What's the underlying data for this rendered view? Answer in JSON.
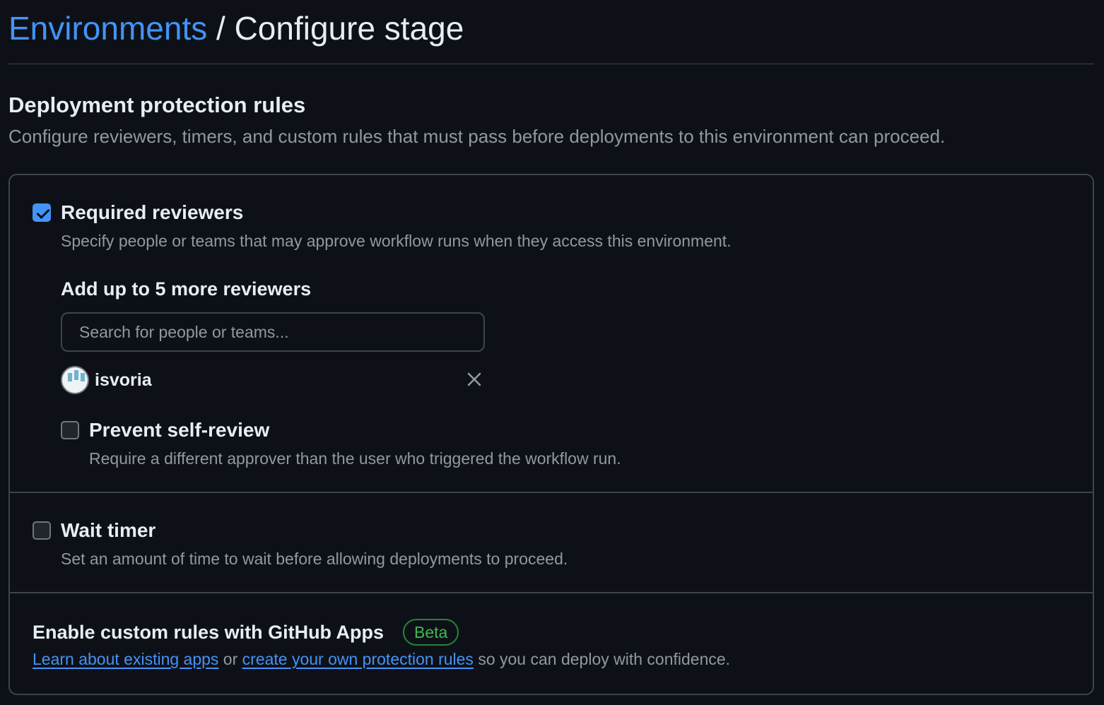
{
  "breadcrumb": {
    "parent": "Environments",
    "separator": " / ",
    "current": "Configure stage"
  },
  "section": {
    "title": "Deployment protection rules",
    "description": "Configure reviewers, timers, and custom rules that must pass before deployments to this environment can proceed."
  },
  "required_reviewers": {
    "checked": true,
    "label": "Required reviewers",
    "description": "Specify people or teams that may approve workflow runs when they access this environment.",
    "add_label": "Add up to 5 more reviewers",
    "search_placeholder": "Search for people or teams...",
    "reviewers": [
      {
        "name": "isvoria"
      }
    ],
    "prevent_self_review": {
      "checked": false,
      "label": "Prevent self-review",
      "description": "Require a different approver than the user who triggered the workflow run."
    }
  },
  "wait_timer": {
    "checked": false,
    "label": "Wait timer",
    "description": "Set an amount of time to wait before allowing deployments to proceed."
  },
  "custom_rules": {
    "title": "Enable custom rules with GitHub Apps",
    "badge": "Beta",
    "link1": "Learn about existing apps",
    "between": " or ",
    "link2": "create your own protection rules",
    "suffix": " so you can deploy with confidence."
  },
  "colors": {
    "accent": "#4493f8",
    "background": "#0d1117",
    "border": "#3d444d",
    "success": "#3fb950"
  }
}
